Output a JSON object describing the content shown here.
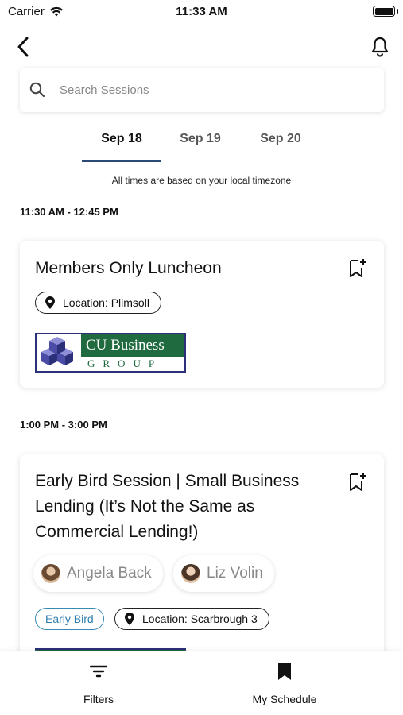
{
  "status_bar": {
    "carrier": "Carrier",
    "time": "11:33 AM"
  },
  "search": {
    "placeholder": "Search Sessions",
    "value": ""
  },
  "tabs": [
    {
      "label": "Sep 18",
      "active": true
    },
    {
      "label": "Sep 19",
      "active": false
    },
    {
      "label": "Sep 20",
      "active": false
    }
  ],
  "timezone_note": "All times are based on your local timezone",
  "sessions": [
    {
      "time": "11:30 AM - 12:45 PM",
      "title": "Members Only Luncheon",
      "location": "Location: Plimsoll",
      "sponsor_logo": {
        "top": "CU Business",
        "bottom": "GROUP"
      }
    },
    {
      "time": "1:00 PM - 3:00 PM",
      "title_lines": [
        "Early Bird Session | Small Business",
        "Lending (It’s Not the Same as",
        "Commercial Lending!)"
      ],
      "speakers": [
        "Angela Back",
        "Liz Volin"
      ],
      "tag": "Early Bird",
      "location": "Location: Scarbrough 3"
    }
  ],
  "bottom_nav": {
    "filters": "Filters",
    "schedule": "My Schedule"
  },
  "colors": {
    "accent": "#2a4a7a",
    "tag": "#2f7fae",
    "logo_green": "#1f6a3f",
    "logo_navy": "#2c2f7a"
  }
}
